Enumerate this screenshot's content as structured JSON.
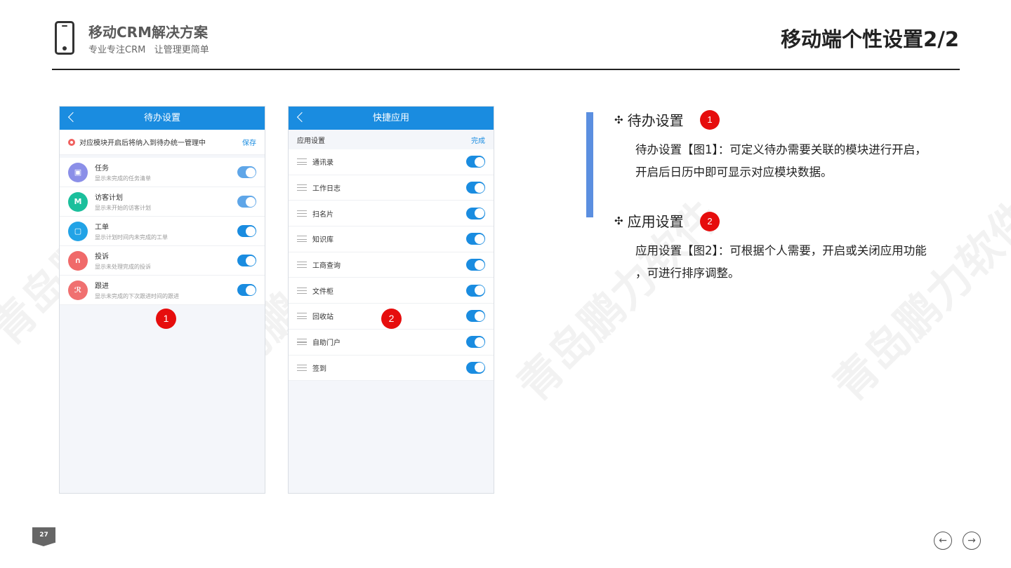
{
  "header": {
    "brand_title": "移动CRM解决方案",
    "brand_subtitle": "专业专注CRM   让管理更简单",
    "page_title": "移动端个性设置2/2"
  },
  "phone1": {
    "title": "待办设置",
    "notice": "对应模块开启后将纳入到待办统一管理中",
    "action": "保存",
    "items": [
      {
        "name": "任务",
        "desc": "显示未完成的任务清单",
        "icon_color": "#8b8fe8",
        "icon": "calendar-icon"
      },
      {
        "name": "访客计划",
        "desc": "显示未开始的访客计划",
        "icon_color": "#1bbf9c",
        "icon": "visitor-icon"
      },
      {
        "name": "工单",
        "desc": "显示计划时间内未完成的工单",
        "icon_color": "#22a3e6",
        "icon": "ticket-icon"
      },
      {
        "name": "投诉",
        "desc": "显示未处理完成的投诉",
        "icon_color": "#f06a6a",
        "icon": "headset-icon"
      },
      {
        "name": "跟进",
        "desc": "显示未完成的下次跟进时间的跟进",
        "icon_color": "#f07070",
        "icon": "runner-icon"
      }
    ],
    "badge": "1"
  },
  "phone2": {
    "title": "快捷应用",
    "section": "应用设置",
    "action": "完成",
    "items": [
      "通讯录",
      "工作日志",
      "扫名片",
      "知识库",
      "工商查询",
      "文件柜",
      "回收站",
      "自助门户",
      "签到"
    ],
    "badge": "2"
  },
  "description": {
    "sec1_title": "待办设置",
    "sec1_badge": "1",
    "sec1_line1": "待办设置【图1】：可定义待办需要关联的模块进行开启，",
    "sec1_line2": "开启后日历中即可显示对应模块数据。",
    "sec2_title": "应用设置",
    "sec2_badge": "2",
    "sec2_line1": "应用设置【图2】：可根据个人需要，开启或关闭应用功能",
    "sec2_line2": "，可进行排序调整。"
  },
  "footer": {
    "page_number": "27"
  },
  "watermark": "青岛鹏力软件",
  "colors": {
    "primary_blue": "#1a8ce0",
    "badge_red": "#e60d0d",
    "accent_bar": "#5b8fe0"
  }
}
